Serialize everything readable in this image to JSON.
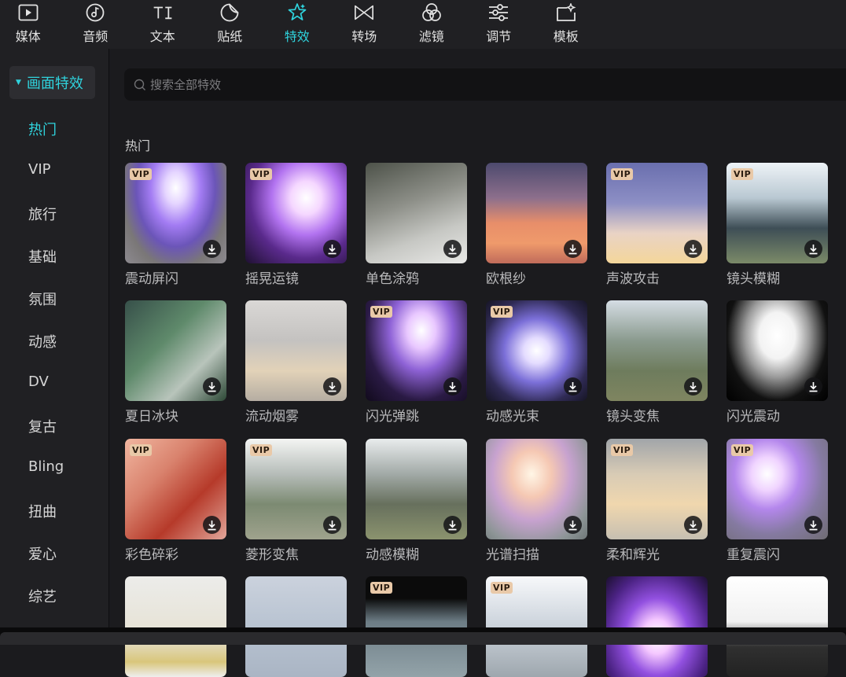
{
  "toolbar": {
    "tabs": [
      {
        "label": "媒体",
        "icon": "media-icon"
      },
      {
        "label": "音频",
        "icon": "audio-icon"
      },
      {
        "label": "文本",
        "icon": "text-icon"
      },
      {
        "label": "贴纸",
        "icon": "sticker-icon"
      },
      {
        "label": "特效",
        "icon": "effects-icon",
        "active": true
      },
      {
        "label": "转场",
        "icon": "transition-icon"
      },
      {
        "label": "滤镜",
        "icon": "filter-icon"
      },
      {
        "label": "调节",
        "icon": "adjust-icon"
      },
      {
        "label": "模板",
        "icon": "template-icon"
      }
    ],
    "active_color": "#2fd3dd"
  },
  "sidebar": {
    "header": "画面特效",
    "items": [
      "热门",
      "VIP",
      "旅行",
      "基础",
      "氛围",
      "动感",
      "DV",
      "复古",
      "Bling",
      "扭曲",
      "爱心",
      "综艺"
    ],
    "active_item": "热门"
  },
  "search": {
    "placeholder": "搜索全部特效"
  },
  "section": {
    "title": "热门"
  },
  "vip_badge": "VIP",
  "effects": [
    {
      "name": "震动屏闪",
      "vip": true
    },
    {
      "name": "摇晃运镜",
      "vip": true
    },
    {
      "name": "单色涂鸦",
      "vip": false
    },
    {
      "name": "欧根纱",
      "vip": false
    },
    {
      "name": "声波攻击",
      "vip": true
    },
    {
      "name": "镜头模糊",
      "vip": true
    },
    {
      "name": "夏日冰块",
      "vip": false
    },
    {
      "name": "流动烟雾",
      "vip": false
    },
    {
      "name": "闪光弹跳",
      "vip": true
    },
    {
      "name": "动感光束",
      "vip": true
    },
    {
      "name": "镜头变焦",
      "vip": false
    },
    {
      "name": "闪光震动",
      "vip": false
    },
    {
      "name": "彩色碎彩",
      "vip": true
    },
    {
      "name": "菱形变焦",
      "vip": true
    },
    {
      "name": "动感模糊",
      "vip": false
    },
    {
      "name": "光谱扫描",
      "vip": false
    },
    {
      "name": "柔和辉光",
      "vip": true
    },
    {
      "name": "重复震闪",
      "vip": true
    },
    {
      "name": "",
      "vip": false
    },
    {
      "name": "",
      "vip": false
    },
    {
      "name": "",
      "vip": true
    },
    {
      "name": "",
      "vip": true
    },
    {
      "name": "",
      "vip": false
    },
    {
      "name": "",
      "vip": false
    }
  ]
}
